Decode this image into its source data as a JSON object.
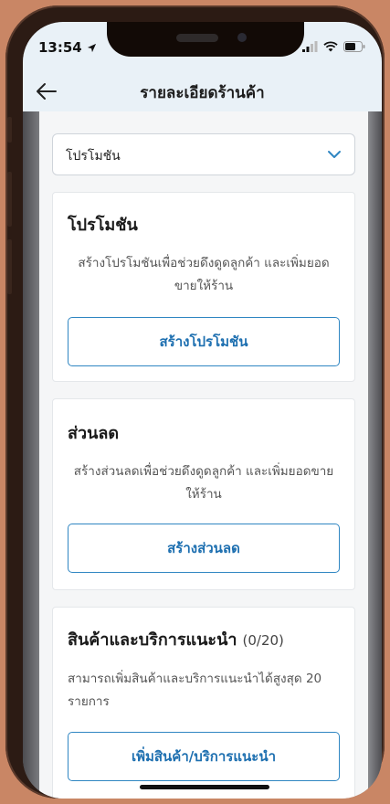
{
  "status_bar": {
    "time": "13:54"
  },
  "header": {
    "title": "รายละเอียดร้านค้า"
  },
  "dropdown": {
    "value": "โปรโมชัน"
  },
  "cards": [
    {
      "title": "โปรโมชัน",
      "description": "สร้างโปรโมชันเพื่อช่วยดึงดูดลูกค้า และเพิ่มยอดขายให้ร้าน",
      "button": "สร้างโปรโมชัน"
    },
    {
      "title": "ส่วนลด",
      "description": "สร้างส่วนลดเพื่อช่วยดึงดูดลูกค้า และเพิ่มยอดขายให้ร้าน",
      "button": "สร้างส่วนลด"
    },
    {
      "title": "สินค้าและบริการแนะนำ",
      "count": "(0/20)",
      "description": "สามารถเพิ่มสินค้าและบริการแนะนำได้สูงสุด 20 รายการ",
      "button": "เพิ่มสินค้า/บริการแนะนำ"
    }
  ],
  "colors": {
    "accent": "#2f86c2",
    "header_bg": "#e9f1f7",
    "page_bg": "#f5f6f7"
  }
}
